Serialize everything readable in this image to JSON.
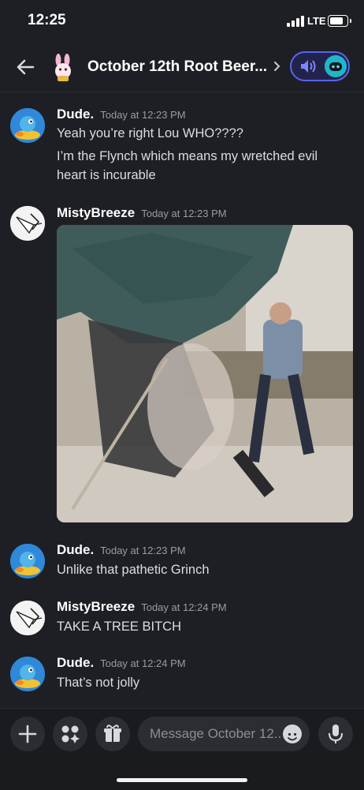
{
  "status_bar": {
    "time": "12:25",
    "network": "LTE"
  },
  "header": {
    "channel_title": "October 12th Root Beer...",
    "icons": [
      "back-arrow-icon",
      "bunny-channel-avatar",
      "chevron-right-icon",
      "speaker-icon",
      "bot-avatar-icon"
    ],
    "accent_color": "#5865f2"
  },
  "messages": [
    {
      "author": "Dude.",
      "timestamp": "Today at 12:23 PM",
      "lines": [
        "Yeah you’re right Lou WHO????",
        "I’m the Flynch which means my wretched evil heart is incurable"
      ]
    },
    {
      "author": "MistyBreeze",
      "timestamp": "Today at 12:23 PM",
      "attachment": "video-embed"
    },
    {
      "author": "Dude.",
      "timestamp": "Today at 12:23 PM",
      "lines": [
        "Unlike that pathetic Grinch"
      ]
    },
    {
      "author": "MistyBreeze",
      "timestamp": "Today at 12:24 PM",
      "lines": [
        "TAKE A TREE BITCH"
      ]
    },
    {
      "author": "Dude.",
      "timestamp": "Today at 12:24 PM",
      "lines": [
        "That’s not jolly"
      ]
    }
  ],
  "composer": {
    "placeholder": "Message October 12..",
    "buttons": [
      "plus-icon",
      "apps-icon",
      "gift-icon",
      "emoji-icon",
      "microphone-icon"
    ]
  }
}
